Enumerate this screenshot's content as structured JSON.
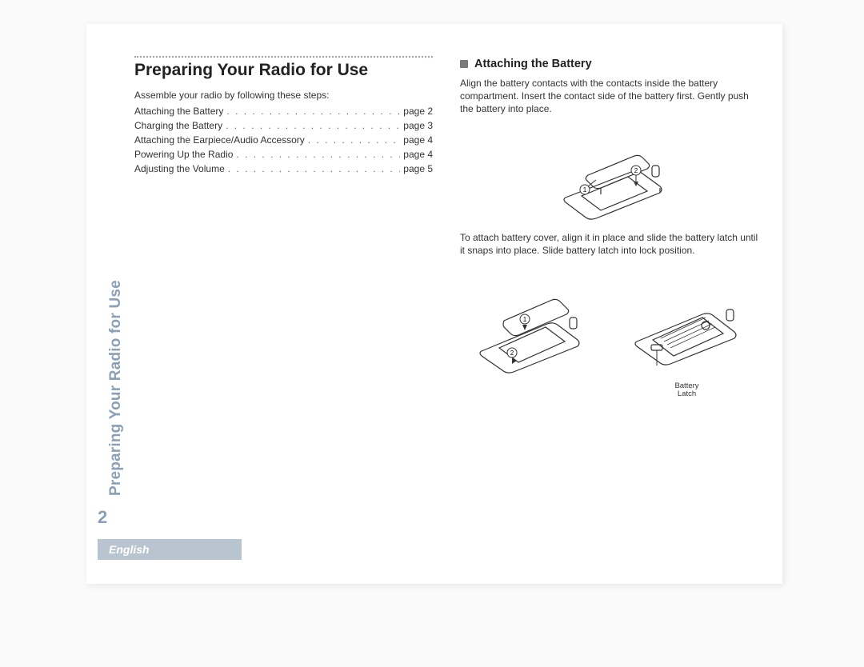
{
  "sidebar": {
    "title": "Preparing Your Radio for Use"
  },
  "page_number": "2",
  "language_label": "English",
  "left": {
    "chapter_title": "Preparing Your Radio for Use",
    "intro": "Assemble your radio by following these steps:",
    "toc": [
      {
        "label": "Attaching the Battery",
        "page": "page 2"
      },
      {
        "label": "Charging the Battery",
        "page": "page 3"
      },
      {
        "label": "Attaching the Earpiece/Audio Accessory",
        "page": "page 4"
      },
      {
        "label": "Powering Up the Radio",
        "page": "page 4"
      },
      {
        "label": "Adjusting the Volume",
        "page": "page 5"
      }
    ]
  },
  "right": {
    "section_title": "Attaching the Battery",
    "para1": "Align the battery contacts with the contacts inside the battery compartment. Insert the contact side of the battery first. Gently push the battery into place.",
    "para2": "To attach battery cover, align it in place and slide the battery latch until it snaps into place. Slide battery latch into lock position.",
    "fig_caption": "Battery\nLatch"
  }
}
